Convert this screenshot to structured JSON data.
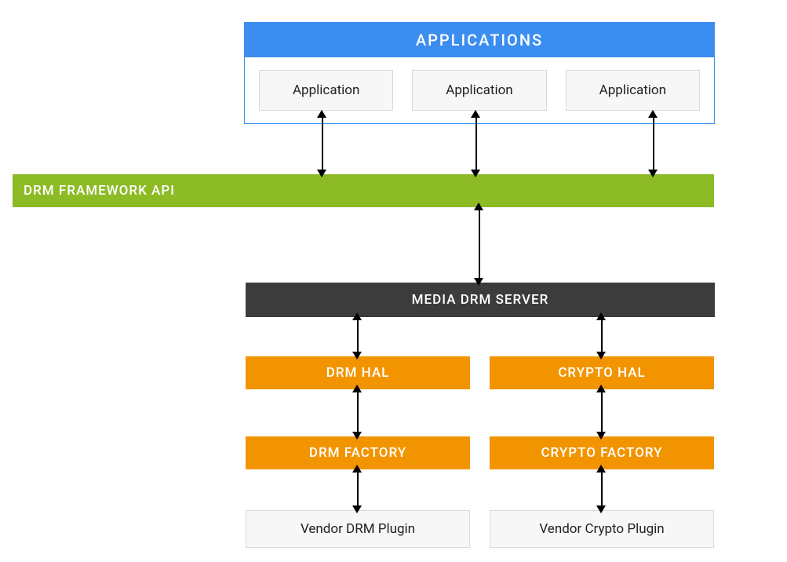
{
  "applications": {
    "header": "APPLICATIONS",
    "items": [
      "Application",
      "Application",
      "Application"
    ]
  },
  "framework": {
    "label": "DRM FRAMEWORK API"
  },
  "media_server": {
    "label": "MEDIA DRM SERVER"
  },
  "hal": {
    "drm": "DRM HAL",
    "crypto": "CRYPTO HAL"
  },
  "factory": {
    "drm": "DRM FACTORY",
    "crypto": "CRYPTO FACTORY"
  },
  "vendor": {
    "drm": "Vendor DRM Plugin",
    "crypto": "Vendor Crypto Plugin"
  },
  "colors": {
    "blue": "#3b8ef0",
    "green": "#8cbb26",
    "dark": "#3c3c3c",
    "orange": "#f29400",
    "grey_box": "#f7f7f7",
    "grey_border": "#d9d9d9"
  }
}
